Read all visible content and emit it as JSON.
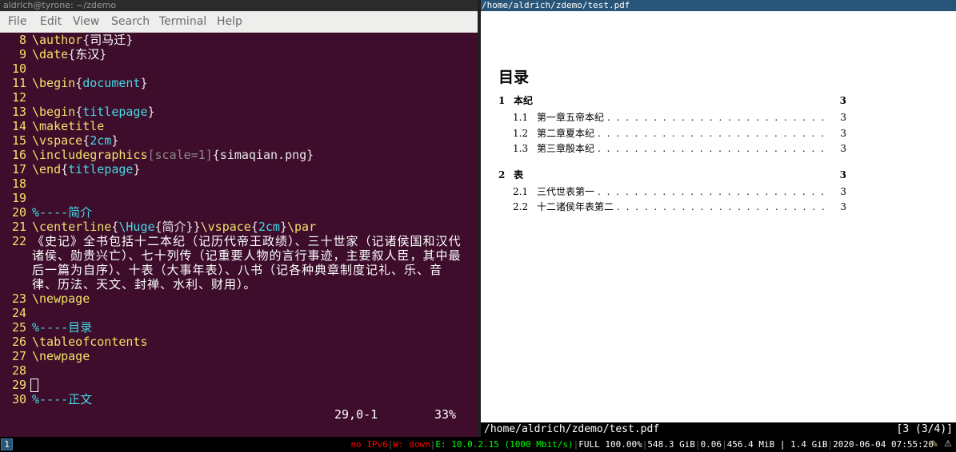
{
  "terminal": {
    "title": "aldrich@tyrone: ~/zdemo",
    "menu": [
      "File",
      "Edit",
      "View",
      "Search",
      "Terminal",
      "Help"
    ],
    "lines": [
      {
        "n": "8",
        "parts": [
          [
            "kw",
            "\\author"
          ],
          [
            "br",
            "{"
          ],
          [
            "txt",
            "司马迁"
          ],
          [
            "br",
            "}"
          ]
        ]
      },
      {
        "n": "9",
        "parts": [
          [
            "kw",
            "\\date"
          ],
          [
            "br",
            "{"
          ],
          [
            "txt",
            "东汉"
          ],
          [
            "br",
            "}"
          ]
        ]
      },
      {
        "n": "10",
        "parts": []
      },
      {
        "n": "11",
        "parts": [
          [
            "kw",
            "\\begin"
          ],
          [
            "br",
            "{"
          ],
          [
            "ar",
            "document"
          ],
          [
            "br",
            "}"
          ]
        ]
      },
      {
        "n": "12",
        "parts": []
      },
      {
        "n": "13",
        "parts": [
          [
            "kw",
            "\\begin"
          ],
          [
            "br",
            "{"
          ],
          [
            "ar",
            "titlepage"
          ],
          [
            "br",
            "}"
          ]
        ]
      },
      {
        "n": "14",
        "parts": [
          [
            "kw",
            "\\maketitle"
          ]
        ]
      },
      {
        "n": "15",
        "parts": [
          [
            "kw",
            "\\vspace"
          ],
          [
            "br",
            "{"
          ],
          [
            "ar",
            "2cm"
          ],
          [
            "br",
            "}"
          ]
        ]
      },
      {
        "n": "16",
        "parts": [
          [
            "kw",
            "\\includegraphics"
          ],
          [
            "ar2",
            "[scale=1]"
          ],
          [
            "br",
            "{simaqian.png}"
          ]
        ]
      },
      {
        "n": "17",
        "parts": [
          [
            "kw",
            "\\end"
          ],
          [
            "br",
            "{"
          ],
          [
            "ar",
            "titlepage"
          ],
          [
            "br",
            "}"
          ]
        ]
      },
      {
        "n": "18",
        "parts": []
      },
      {
        "n": "19",
        "parts": []
      },
      {
        "n": "20",
        "parts": [
          [
            "cm",
            "%----简介"
          ]
        ]
      },
      {
        "n": "21",
        "parts": [
          [
            "kw",
            "\\centerline"
          ],
          [
            "br",
            "{"
          ],
          [
            "ar",
            "\\Huge"
          ],
          [
            "br",
            "{简介}}"
          ],
          [
            "kw",
            "\\vspace"
          ],
          [
            "br",
            "{"
          ],
          [
            "ar",
            "2cm"
          ],
          [
            "br",
            "}"
          ],
          [
            "kw",
            "\\par"
          ]
        ]
      }
    ],
    "line22_num": "22",
    "line22_text": "《史记》全书包括十二本纪（记历代帝王政绩）、三十世家（记诸侯国和汉代诸侯、勋贵兴亡）、七十列传（记重要人物的言行事迹，主要叙人臣，其中最后一篇为自序）、十表（大事年表）、八书（记各种典章制度记礼、乐、音律、历法、天文、封禅、水利、财用）。",
    "lines_after": [
      {
        "n": "23",
        "parts": [
          [
            "kw",
            "\\newpage"
          ]
        ]
      },
      {
        "n": "24",
        "parts": []
      },
      {
        "n": "25",
        "parts": [
          [
            "cm",
            "%----目录"
          ]
        ]
      },
      {
        "n": "26",
        "parts": [
          [
            "kw",
            "\\tableofcontents"
          ]
        ]
      },
      {
        "n": "27",
        "parts": [
          [
            "kw",
            "\\newpage"
          ]
        ]
      },
      {
        "n": "28",
        "parts": []
      },
      {
        "n": "29",
        "parts": []
      },
      {
        "n": "30",
        "parts": [
          [
            "cm",
            "%----正文"
          ]
        ]
      }
    ],
    "status_position": "29,0-1",
    "status_percent": "33%"
  },
  "pdf": {
    "title": "/home/aldrich/zdemo/test.pdf",
    "toc_heading": "目录",
    "toc": [
      {
        "num": "1",
        "title": "本纪",
        "page": "3",
        "level": 1
      },
      {
        "num": "1.1",
        "title": "第一章五帝本纪",
        "page": "3",
        "level": 2
      },
      {
        "num": "1.2",
        "title": "第二章夏本纪",
        "page": "3",
        "level": 2
      },
      {
        "num": "1.3",
        "title": "第三章殷本纪",
        "page": "3",
        "level": 2
      },
      {
        "num": "2",
        "title": "表",
        "page": "3",
        "level": 1
      },
      {
        "num": "2.1",
        "title": "三代世表第一",
        "page": "3",
        "level": 2
      },
      {
        "num": "2.2",
        "title": "十二诸侯年表第二",
        "page": "3",
        "level": 2
      }
    ],
    "status_path": "/home/aldrich/zdemo/test.pdf",
    "status_page": "[3 (3/4)]"
  },
  "bar": {
    "workspace": "1",
    "ipv6": "no IPv6",
    "wifi": "W: down",
    "eth": "E: 10.0.2.15 (1000 Mbit/s)",
    "battery": "FULL 100.00%",
    "disk": "548.3 GiB",
    "load": "0.06",
    "mem": "456.4 MiB | 1.4 GiB",
    "datetime": "2020-06-04 07:55:20"
  },
  "colors": {
    "terminal_bg": "#3d0d2b",
    "keyword": "#f3e06b",
    "argument": "#46d9e6",
    "titlebar_focused": "#285577"
  }
}
